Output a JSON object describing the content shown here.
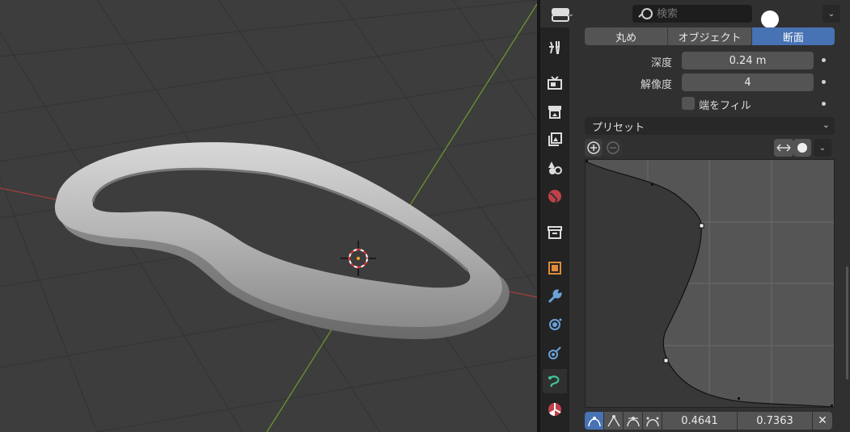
{
  "header": {
    "editor_type_icon": "properties-editor-icon",
    "search_placeholder": "検索"
  },
  "tabs": [
    {
      "name": "tool-tab",
      "icon": "tool-icon"
    },
    {
      "name": "render-tab",
      "icon": "render-icon"
    },
    {
      "name": "output-tab",
      "icon": "output-icon"
    },
    {
      "name": "view-layer-tab",
      "icon": "view-layer-icon"
    },
    {
      "name": "scene-tab",
      "icon": "scene-icon"
    },
    {
      "name": "world-tab",
      "icon": "world-icon"
    },
    {
      "name": "collection-tab",
      "icon": "collection-icon"
    },
    {
      "name": "object-tab",
      "icon": "object-icon"
    },
    {
      "name": "modifier-tab",
      "icon": "wrench-icon"
    },
    {
      "name": "particles-tab",
      "icon": "particles-icon"
    },
    {
      "name": "physics-tab",
      "icon": "physics-icon"
    },
    {
      "name": "data-tab",
      "icon": "curve-data-icon",
      "active": true
    },
    {
      "name": "material-tab",
      "icon": "material-icon"
    }
  ],
  "bevel": {
    "modes": [
      {
        "label": "丸め",
        "active": false
      },
      {
        "label": "オブジェクト",
        "active": false
      },
      {
        "label": "断面",
        "active": true
      }
    ],
    "depth_label": "深度",
    "depth_value": "0.24 m",
    "resolution_label": "解像度",
    "resolution_value": "4",
    "fill_caps_label": "端をフィル",
    "fill_caps_checked": false
  },
  "profile": {
    "preset_label": "プリセット",
    "clip_icon": "clip-arrows-icon",
    "point_x": "0.4641",
    "point_y": "0.7363",
    "handle_types": [
      "auto-handle-icon",
      "vector-handle-icon",
      "auto-clamped-handle-icon",
      "aligned-handle-icon"
    ]
  },
  "colors": {
    "accent": "#4772b3",
    "panel_bg": "#303030",
    "viewport_bg": "#3d3d3d",
    "x_axis": "#a63d3d",
    "y_axis": "#6d9b2e"
  }
}
